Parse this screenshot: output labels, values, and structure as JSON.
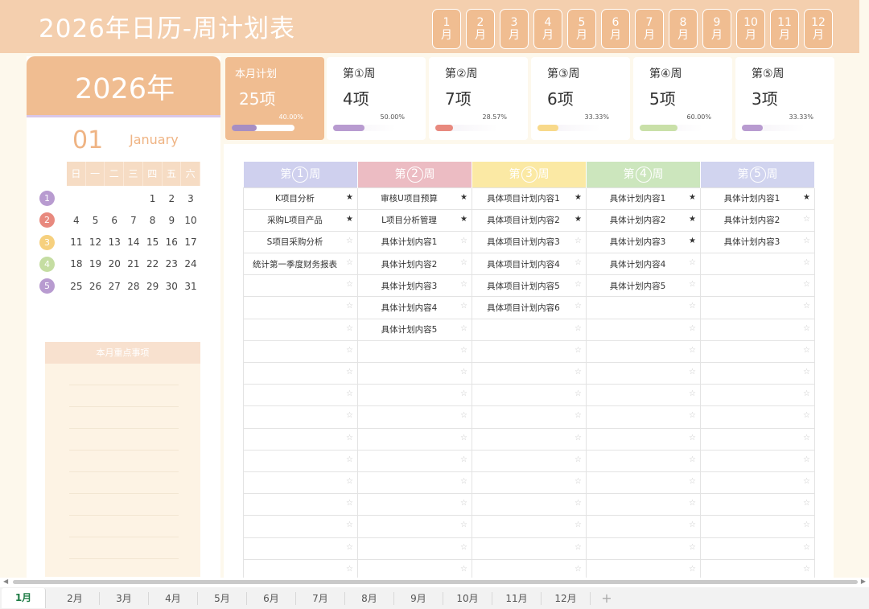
{
  "header": {
    "title": "2026年日历-周计划表",
    "months": [
      "1 月",
      "2 月",
      "3 月",
      "4 月",
      "5 月",
      "6 月",
      "7 月",
      "8 月",
      "9 月",
      "10 月",
      "11 月",
      "12 月"
    ]
  },
  "left": {
    "year": "2026年",
    "month_num": "01",
    "month_name": "January",
    "weekdays": [
      "日",
      "一",
      "二",
      "三",
      "四",
      "五",
      "六"
    ],
    "weeks": [
      {
        "num": "1",
        "color": "#b89bd0",
        "days": [
          "",
          "",
          "",
          "",
          "1",
          "2",
          "3"
        ]
      },
      {
        "num": "2",
        "color": "#e8897e",
        "days": [
          "4",
          "5",
          "6",
          "7",
          "8",
          "9",
          "10"
        ]
      },
      {
        "num": "3",
        "color": "#f6d07e",
        "days": [
          "11",
          "12",
          "13",
          "14",
          "15",
          "16",
          "17"
        ]
      },
      {
        "num": "4",
        "color": "#c5dda2",
        "days": [
          "18",
          "19",
          "20",
          "21",
          "22",
          "23",
          "24"
        ]
      },
      {
        "num": "5",
        "color": "#b89bd0",
        "days": [
          "25",
          "26",
          "27",
          "28",
          "29",
          "30",
          "31"
        ]
      }
    ],
    "key_title": "本月重点事项"
  },
  "cards": [
    {
      "title": "本月计划",
      "count": "25项",
      "pct": "40.00%",
      "value": 0.4,
      "color": "#a78ec2",
      "main": true
    },
    {
      "title": "第①周",
      "count": "4项",
      "pct": "50.00%",
      "value": 0.5,
      "color": "#b89bd0",
      "main": false
    },
    {
      "title": "第②周",
      "count": "7项",
      "pct": "28.57%",
      "value": 0.2857,
      "color": "#e8897e",
      "main": false
    },
    {
      "title": "第③周",
      "count": "6项",
      "pct": "33.33%",
      "value": 0.3333,
      "color": "#f8d98a",
      "main": false
    },
    {
      "title": "第④周",
      "count": "5项",
      "pct": "60.00%",
      "value": 0.6,
      "color": "#c9e0a8",
      "main": false
    },
    {
      "title": "第⑤周",
      "count": "3项",
      "pct": "33.33%",
      "value": 0.3333,
      "color": "#b89bd0",
      "main": false
    }
  ],
  "table": {
    "columns": [
      {
        "pre": "第",
        "num": "1",
        "post": "周",
        "color": "#cfd0ee"
      },
      {
        "pre": "第",
        "num": "2",
        "post": "周",
        "color": "#ecbcc3"
      },
      {
        "pre": "第",
        "num": "3",
        "post": "周",
        "color": "#fbe9a4"
      },
      {
        "pre": "第",
        "num": "4",
        "post": "周",
        "color": "#cce6bd"
      },
      {
        "pre": "第",
        "num": "5",
        "post": "周",
        "color": "#d1d4ef"
      }
    ],
    "row_count": 18,
    "tasks": [
      [
        {
          "t": "K项目分析",
          "s": true
        },
        {
          "t": "采购L项目产品",
          "s": true
        },
        {
          "t": "S项目采购分析",
          "s": false
        },
        {
          "t": "统计第一季度财务报表",
          "s": false
        }
      ],
      [
        {
          "t": "审核U项目预算",
          "s": true
        },
        {
          "t": "L项目分析管理",
          "s": true
        },
        {
          "t": "具体计划内容1",
          "s": false
        },
        {
          "t": "具体计划内容2",
          "s": false
        },
        {
          "t": "具体计划内容3",
          "s": false
        },
        {
          "t": "具体计划内容4",
          "s": false
        },
        {
          "t": "具体计划内容5",
          "s": false
        }
      ],
      [
        {
          "t": "具体项目计划内容1",
          "s": true
        },
        {
          "t": "具体项目计划内容2",
          "s": true
        },
        {
          "t": "具体项目计划内容3",
          "s": false
        },
        {
          "t": "具体项目计划内容4",
          "s": false
        },
        {
          "t": "具体项目计划内容5",
          "s": false
        },
        {
          "t": "具体项目计划内容6",
          "s": false
        }
      ],
      [
        {
          "t": "具体计划内容1",
          "s": true
        },
        {
          "t": "具体计划内容2",
          "s": true
        },
        {
          "t": "具体计划内容3",
          "s": true
        },
        {
          "t": "具体计划内容4",
          "s": false
        },
        {
          "t": "具体计划内容5",
          "s": false
        }
      ],
      [
        {
          "t": "具体计划内容1",
          "s": true
        },
        {
          "t": "具体计划内容2",
          "s": false
        },
        {
          "t": "具体计划内容3",
          "s": false
        }
      ]
    ]
  },
  "sheet_tabs": [
    "1月",
    "2月",
    "3月",
    "4月",
    "5月",
    "6月",
    "7月",
    "8月",
    "9月",
    "10月",
    "11月",
    "12月"
  ],
  "active_sheet": "1月",
  "add_sheet": "+",
  "icons": {
    "star_on": "★",
    "star_off": "☆",
    "scroll_left": "◀",
    "scroll_right": "▶"
  }
}
